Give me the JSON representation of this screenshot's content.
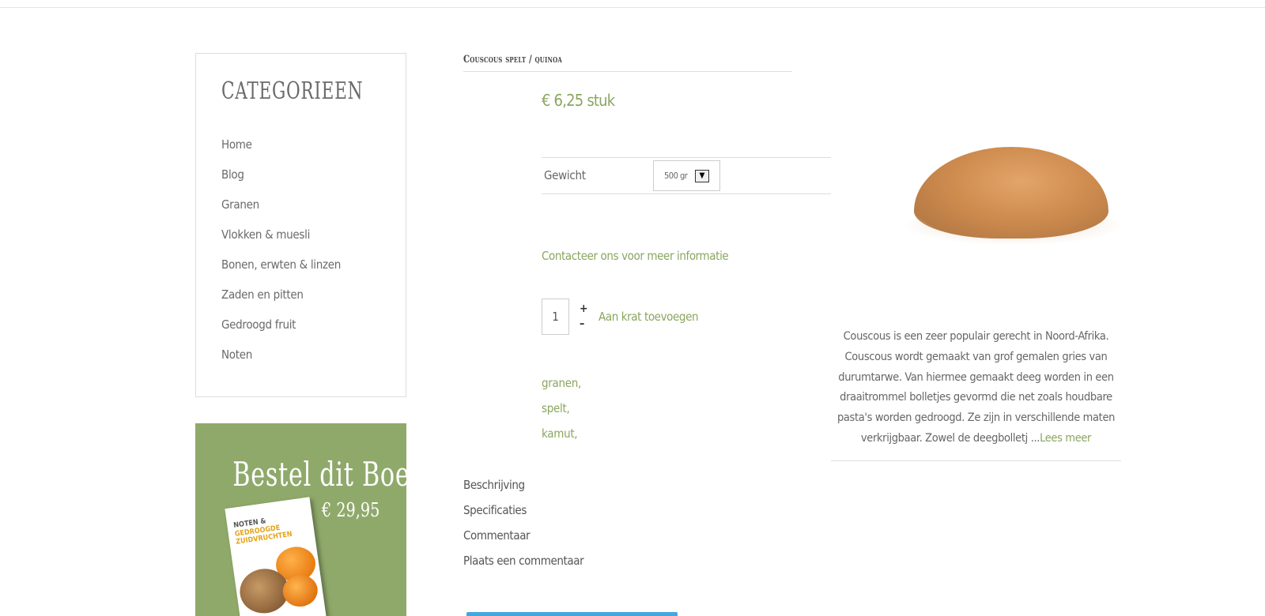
{
  "sidebar": {
    "title": "CATEGORIEEN",
    "items": [
      {
        "label": "Home"
      },
      {
        "label": "Blog"
      },
      {
        "label": "Granen"
      },
      {
        "label": "Vlokken & muesli"
      },
      {
        "label": "Bonen, erwten & linzen"
      },
      {
        "label": "Zaden en pitten"
      },
      {
        "label": "Gedroogd fruit"
      },
      {
        "label": "Noten"
      }
    ]
  },
  "promo": {
    "headline": "Bestel dit Boek",
    "price": "€ 29,95",
    "book_title_line1": "NOTEN &",
    "book_title_line2": "GEDROOGDE ZUIDVRUCHTEN",
    "accent_color": "#8fa96a"
  },
  "product": {
    "title": "Couscous spelt / quinoa",
    "price": "€ 6,25 stuk",
    "variation": {
      "label": "Gewicht",
      "selected": "500 gr"
    },
    "contact_link": "Contacteer ons voor meer informatie",
    "quantity": "1",
    "plus": "+",
    "minus": "–",
    "add_to_cart": "Aan krat toevoegen",
    "tags": [
      "granen,",
      "spelt,",
      "kamut,"
    ],
    "tabs": [
      "Beschrijving",
      "Specificaties",
      "Commentaar",
      "Plaats een commentaar"
    ],
    "description": "Couscous is een zeer populair gerecht in Noord-Afrika. Couscous wordt gemaakt van grof gemalen gries van durumtarwe. Van hiermee gemaakt deeg worden in een draaitrommel bolletjes gevormd die net zoals houdbare pasta's worden gedroogd. Ze zijn in verschillende maten verkrijgbaar. Zowel de deegbolletj ...",
    "read_more": "Lees meer",
    "accent_color": "#8aa660"
  }
}
